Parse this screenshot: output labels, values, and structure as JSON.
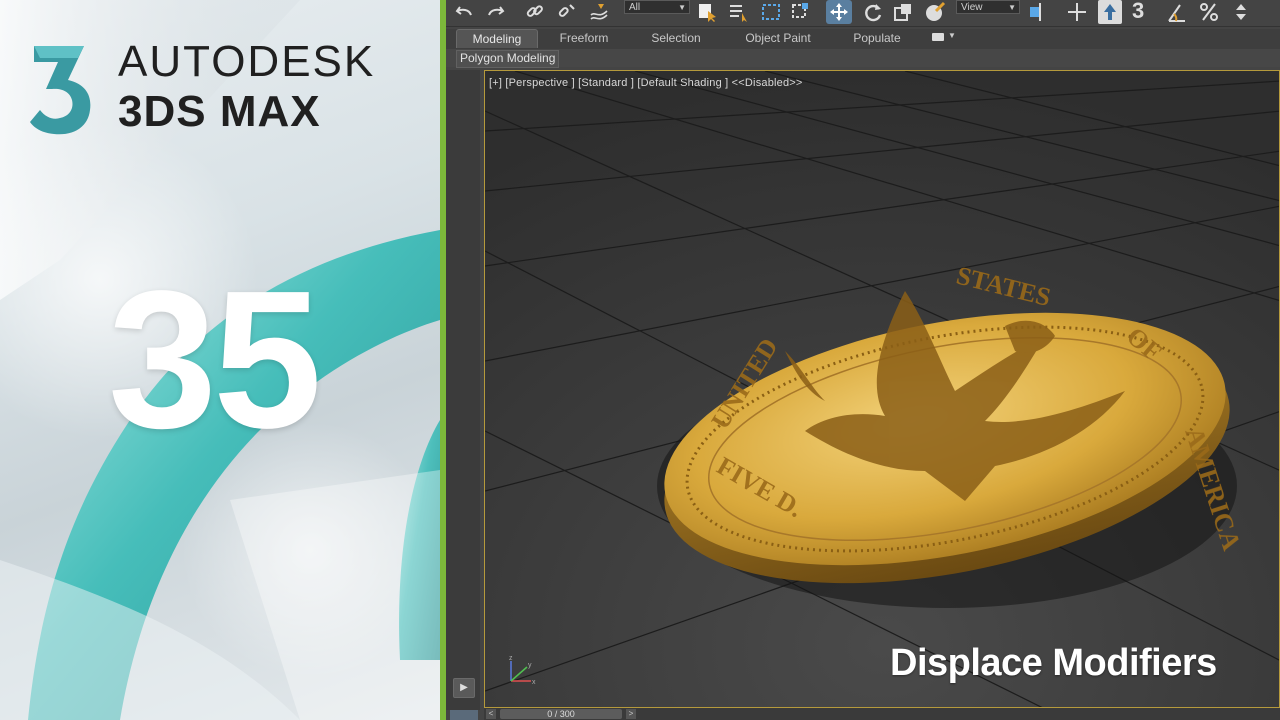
{
  "brand": {
    "logo_digit": "3",
    "title_line1": "AUTODESK",
    "title_line2": "3DS MAX",
    "episode_number": "35",
    "accent_green": "#7cb83a",
    "accent_teal": "#3fbcb8"
  },
  "toolbar": {
    "selection_filter": "All",
    "ref_coord_system": "View",
    "snap_label": "3",
    "icons": [
      "undo-icon",
      "redo-icon",
      "link-icon",
      "unlink-icon",
      "bind-space-warp-icon",
      "select-object-icon",
      "select-by-name-icon",
      "rectangular-selection-icon",
      "window-crossing-icon",
      "select-and-move-icon",
      "select-and-rotate-icon",
      "select-and-scale-icon",
      "select-and-place-icon",
      "use-pivot-point-icon",
      "select-and-manipulate-icon",
      "keyboard-shortcut-override-icon",
      "snaps-toggle-icon",
      "angle-snap-icon",
      "percent-snap-icon",
      "spinner-snap-icon"
    ]
  },
  "ribbon": {
    "tabs": [
      "Modeling",
      "Freeform",
      "Selection",
      "Object Paint",
      "Populate"
    ],
    "active_tab": "Modeling",
    "sub_panel": "Polygon Modeling"
  },
  "viewport": {
    "label": "[+] [Perspective ] [Standard ] [Default Shading ]  <<Disabled>>",
    "border_color": "#b59a3c",
    "object_name": "gold-coin",
    "coin_inscription": "UNITED STATES OF AMERICA FIVE D."
  },
  "timeline": {
    "frame_display": "0 / 300",
    "prev": "<",
    "next": ">"
  },
  "caption": "Displace Modifiers"
}
